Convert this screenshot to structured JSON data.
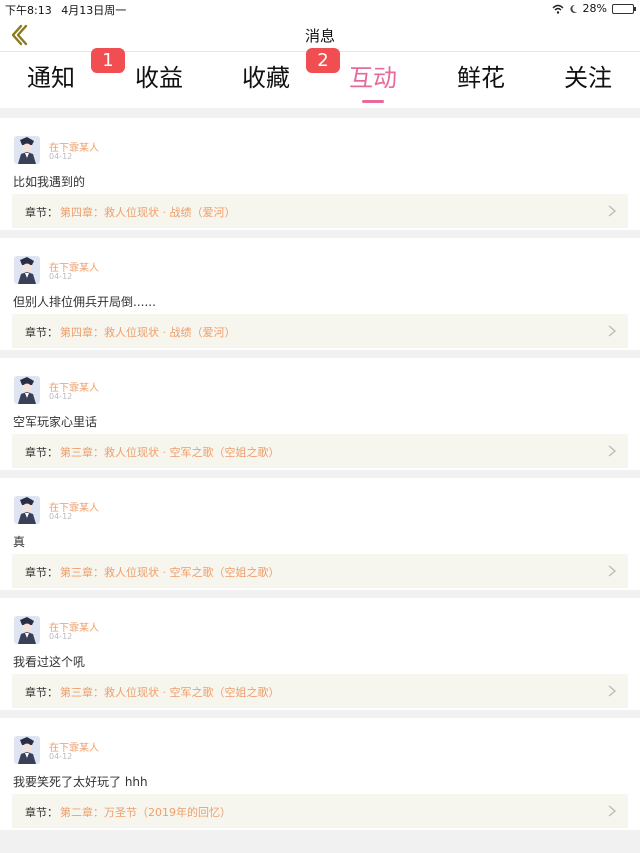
{
  "status_bar": {
    "time": "下午8:13",
    "date": "4月13日周一",
    "battery": "28%",
    "battery_level": 0.28
  },
  "nav": {
    "title": "消息"
  },
  "tabs": [
    {
      "label": "通知",
      "badge": "1"
    },
    {
      "label": "收益",
      "badge": ""
    },
    {
      "label": "收藏",
      "badge": "2"
    },
    {
      "label": "互动",
      "badge": "",
      "active": true
    },
    {
      "label": "鲜花",
      "badge": ""
    },
    {
      "label": "关注",
      "badge": ""
    }
  ],
  "chapter_label": "章节：",
  "comments": [
    {
      "user": "在下霏某人",
      "date": "04-12",
      "text": "比如我遇到的",
      "chapter": "第四章：救人位现状 · 战绩（爱河）"
    },
    {
      "user": "在下霏某人",
      "date": "04-12",
      "text": "但别人排位佣兵开局倒......",
      "chapter": "第四章：救人位现状 · 战绩（爱河）"
    },
    {
      "user": "在下霏某人",
      "date": "04-12",
      "text": "空军玩家心里话",
      "chapter": "第三章：救人位现状 · 空军之歌（空姐之歌）"
    },
    {
      "user": "在下霏某人",
      "date": "04-12",
      "text": "真",
      "chapter": "第三章：救人位现状 · 空军之歌（空姐之歌）"
    },
    {
      "user": "在下霏某人",
      "date": "04-12",
      "text": "我看过这个吼",
      "chapter": "第三章：救人位现状 · 空军之歌（空姐之歌）"
    },
    {
      "user": "在下霏某人",
      "date": "04-12",
      "text": "我要笑死了太好玩了 hhh",
      "chapter": "第二章：万圣节（2019年的回忆）"
    }
  ]
}
